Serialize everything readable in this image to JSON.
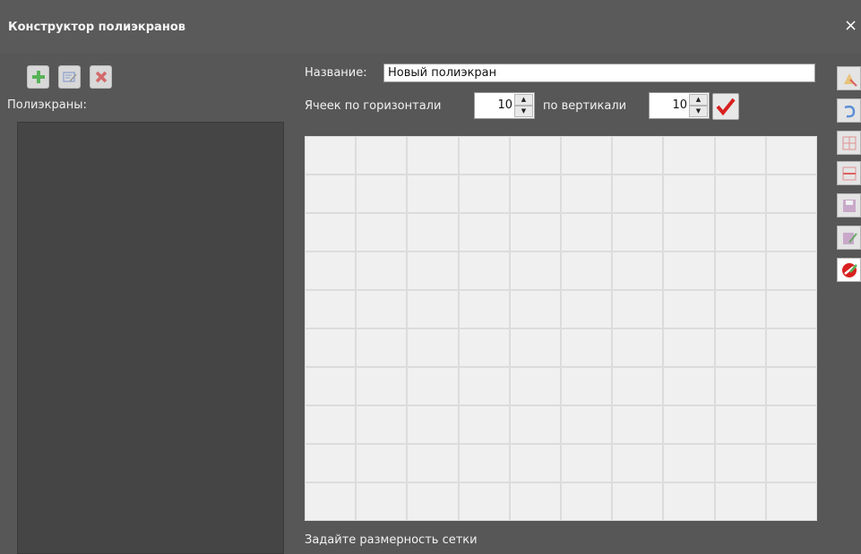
{
  "window": {
    "title": "Конструктор полиэкранов",
    "close_glyph": "×"
  },
  "left": {
    "toolbar": [
      {
        "name": "add-button",
        "icon": "plus-icon"
      },
      {
        "name": "edit-button",
        "icon": "edit-icon"
      },
      {
        "name": "delete-button",
        "icon": "delete-x-icon"
      }
    ],
    "list_label": "Полиэкраны:"
  },
  "form": {
    "name_label": "Название:",
    "name_value": "Новый полиэкран",
    "horiz_label": "Ячеек по горизонтали",
    "horiz_value": "10",
    "vert_label": "по вертикали",
    "vert_value": "10"
  },
  "grid": {
    "rows": 10,
    "cols": 10
  },
  "hint": "Задайте размерность сетки",
  "side_toolbar": [
    "clear-icon",
    "undo-icon",
    "merge-cells-icon",
    "split-cells-icon",
    "save-icon",
    "save-as-icon",
    "cancel-icon"
  ],
  "colors": {
    "accent_red": "#d92020",
    "accent_green": "#4caf50"
  }
}
